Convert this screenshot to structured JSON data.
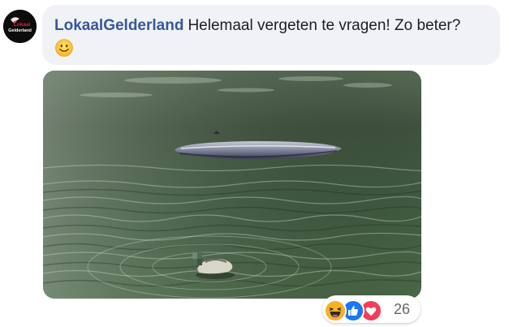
{
  "comment": {
    "author": "LokaalGelderland",
    "text": "Helemaal vergeten te vragen! Zo beter?",
    "emoji": "slightly-smiling-face"
  },
  "avatar": {
    "logo_line1": "Lokaal",
    "logo_line2": "Gelderland",
    "brand_colors": {
      "background": "#0c0c0c",
      "accent": "#e0212b",
      "text": "#ffffff"
    }
  },
  "attachment": {
    "type": "photo",
    "subject": "capsized-boat-and-duck-on-water"
  },
  "reactions": {
    "types": [
      "haha",
      "like",
      "love"
    ],
    "count": "26",
    "colors": {
      "haha": "#f7b125",
      "like": "#1877f2",
      "love": "#f33e58"
    }
  },
  "colors": {
    "bubble": "#f0f2f5",
    "author_link": "#385898",
    "text": "#1c1e21",
    "muted": "#65676b"
  }
}
